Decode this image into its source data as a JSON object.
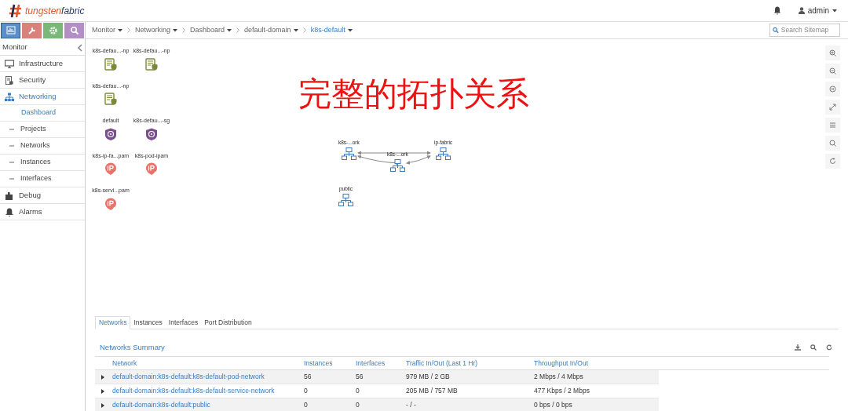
{
  "logo": {
    "brand": "tungsten",
    "suffix": "fabric"
  },
  "header": {
    "user": "admin"
  },
  "toolbar": [
    {
      "kind": "monitor",
      "color": "#5b8fc7",
      "selected": true
    },
    {
      "kind": "configure",
      "color": "#d9827c",
      "selected": false
    },
    {
      "kind": "settings",
      "color": "#7cb77a",
      "selected": false
    },
    {
      "kind": "query",
      "color": "#b48fc6",
      "selected": false
    }
  ],
  "breadcrumb": [
    {
      "label": "Monitor",
      "selected": false
    },
    {
      "label": "Networking",
      "selected": false
    },
    {
      "label": "Dashboard",
      "selected": false
    },
    {
      "label": "default-domain",
      "selected": false
    },
    {
      "label": "k8s-default",
      "selected": true
    }
  ],
  "search": {
    "placeholder": "Search Sitemap"
  },
  "sidebar": {
    "title": "Monitor",
    "items": [
      {
        "label": "Infrastructure",
        "kind": "monitor",
        "selected": false
      },
      {
        "label": "Security",
        "kind": "security",
        "selected": false
      },
      {
        "label": "Networking",
        "kind": "network",
        "selected": true,
        "children": [
          {
            "label": "Dashboard",
            "selected": true
          },
          {
            "label": "Projects",
            "selected": false
          },
          {
            "label": "Networks",
            "selected": false
          },
          {
            "label": "Instances",
            "selected": false
          },
          {
            "label": "Interfaces",
            "selected": false
          }
        ]
      },
      {
        "label": "Debug",
        "kind": "debug",
        "selected": false
      },
      {
        "label": "Alarms",
        "kind": "alarm",
        "selected": false
      }
    ]
  },
  "topology": {
    "annotation": "完整的拓扑关系",
    "resources": [
      {
        "kind": "policy",
        "label": "k8s-defau...-np"
      },
      {
        "kind": "policy",
        "label": "k8s-defau...-np"
      },
      {
        "kind": "policy",
        "label": "k8s-defau...-np"
      },
      {
        "kind": "security-group",
        "label": "default"
      },
      {
        "kind": "security-group",
        "label": "k8s-defau...-sg"
      },
      {
        "kind": "ipam",
        "label": "k8s-ip-fa...pam"
      },
      {
        "kind": "ipam",
        "label": "k8s-pod-ipam"
      },
      {
        "kind": "ipam",
        "label": "k8s-servi...pam"
      }
    ],
    "networks": [
      {
        "label": "k8s-...ork"
      },
      {
        "label": "k8s-...ork"
      },
      {
        "label": "ip-fabric"
      },
      {
        "label": "public"
      }
    ]
  },
  "tabs": [
    {
      "label": "Networks",
      "selected": true
    },
    {
      "label": "Instances",
      "selected": false
    },
    {
      "label": "Interfaces",
      "selected": false
    },
    {
      "label": "Port Distribution",
      "selected": false
    }
  ],
  "summary": {
    "title": "Networks Summary",
    "columns": [
      "Network",
      "Instances",
      "Interfaces",
      "Traffic In/Out (Last 1 Hr)",
      "Throughput In/Out"
    ],
    "rows": [
      {
        "expanded": false,
        "cells": [
          "default-domain:k8s-default:k8s-default-pod-network",
          "56",
          "56",
          "979 MB / 2 GB",
          "2 Mbps / 4 Mbps"
        ]
      },
      {
        "expanded": false,
        "cells": [
          "default-domain:k8s-default:k8s-default-service-network",
          "0",
          "0",
          "205 MB / 757 MB",
          "477 Kbps / 2 Mbps"
        ]
      },
      {
        "expanded": false,
        "cells": [
          "default-domain:k8s-default:public",
          "0",
          "0",
          "- / -",
          "0 bps / 0 bps"
        ]
      }
    ]
  }
}
